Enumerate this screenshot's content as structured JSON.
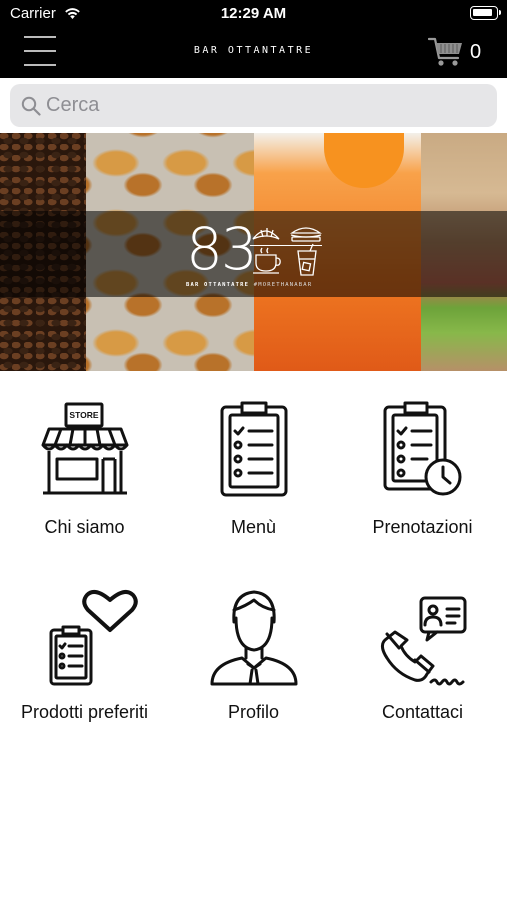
{
  "status_bar": {
    "carrier": "Carrier",
    "time": "12:29 AM",
    "icons": [
      "wifi-icon",
      "battery-icon"
    ]
  },
  "header": {
    "title": "BAR OTTANTATRE",
    "menu_icon": "hamburger-icon",
    "cart_icon": "cart-icon",
    "cart_count": "0"
  },
  "search": {
    "placeholder": "Cerca",
    "value": "",
    "icon": "search-icon"
  },
  "banner": {
    "logo_number": "83",
    "logo_name": "BAR OTTANTATRE",
    "logo_tagline": "#MORETHANABAR",
    "logo_icons": [
      "croissant-icon",
      "sandwich-icon",
      "coffee-cup-icon",
      "drink-icon"
    ]
  },
  "menu_tiles": [
    {
      "label": "Chi siamo",
      "icon": "store-icon",
      "sign": "STORE"
    },
    {
      "label": "Menù",
      "icon": "clipboard-list-icon"
    },
    {
      "label": "Prenotazioni",
      "icon": "clipboard-clock-icon"
    },
    {
      "label": "Prodotti preferiti",
      "icon": "clipboard-heart-icon"
    },
    {
      "label": "Profilo",
      "icon": "user-profile-icon"
    },
    {
      "label": "Contattaci",
      "icon": "phone-contact-icon"
    }
  ],
  "colors": {
    "header_bg": "#000000",
    "search_bg": "#e6e6e8",
    "text": "#111111"
  }
}
